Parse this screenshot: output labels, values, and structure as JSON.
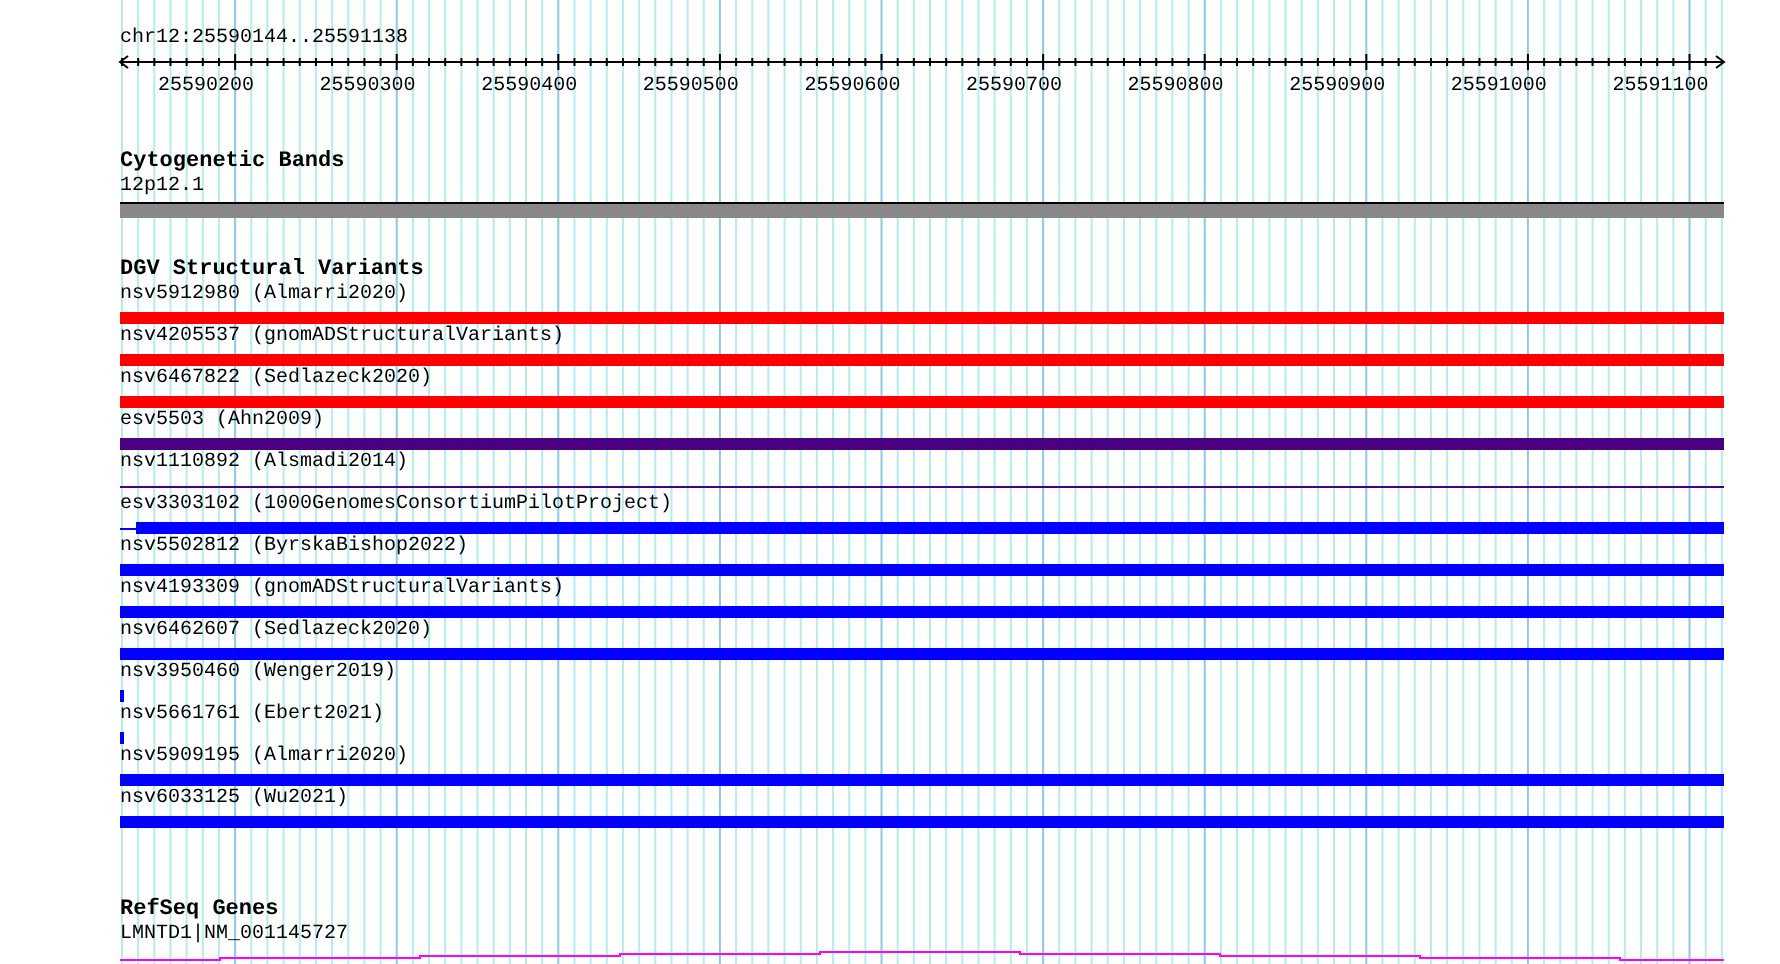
{
  "ruler": {
    "range": "chr12:25590144..25591138",
    "ticks": [
      "25590200",
      "25590300",
      "25590400",
      "25590500",
      "25590600",
      "25590700",
      "25590800",
      "25590900",
      "25591000",
      "25591100"
    ]
  },
  "cytogenetic_bands": {
    "title": "Cytogenetic Bands",
    "label": "12p12.1"
  },
  "dgv": {
    "title": "DGV Structural Variants",
    "variants": [
      {
        "label": "nsv5912980 (Almarri2020)",
        "kind": "thick",
        "color": "#ff0000"
      },
      {
        "label": "nsv4205537 (gnomADStructuralVariants)",
        "kind": "thick",
        "color": "#ff0000"
      },
      {
        "label": "nsv6467822 (Sedlazeck2020)",
        "kind": "thick",
        "color": "#ff0000"
      },
      {
        "label": "esv5503 (Ahn2009)",
        "kind": "thick",
        "color": "#4b0082"
      },
      {
        "label": "nsv1110892 (Alsmadi2014)",
        "kind": "thin",
        "color": "#4b0082"
      },
      {
        "label": "esv3303102 (1000GenomesConsortiumPilotProject)",
        "kind": "partial",
        "color": "#0000ff"
      },
      {
        "label": "nsv5502812 (ByrskaBishop2022)",
        "kind": "thick",
        "color": "#0000ff"
      },
      {
        "label": "nsv4193309 (gnomADStructuralVariants)",
        "kind": "thick",
        "color": "#0000ff"
      },
      {
        "label": "nsv6462607 (Sedlazeck2020)",
        "kind": "thick",
        "color": "#0000ff"
      },
      {
        "label": "nsv3950460 (Wenger2019)",
        "kind": "tick",
        "color": "#0000ff"
      },
      {
        "label": "nsv5661761 (Ebert2021)",
        "kind": "tick",
        "color": "#0000ff"
      },
      {
        "label": "nsv5909195 (Almarri2020)",
        "kind": "thick",
        "color": "#0000ff"
      },
      {
        "label": "nsv6033125 (Wu2021)",
        "kind": "thick",
        "color": "#0000ff"
      }
    ]
  },
  "refseq": {
    "title": "RefSeq Genes",
    "gene": "LMNTD1|NM_001145727"
  }
}
